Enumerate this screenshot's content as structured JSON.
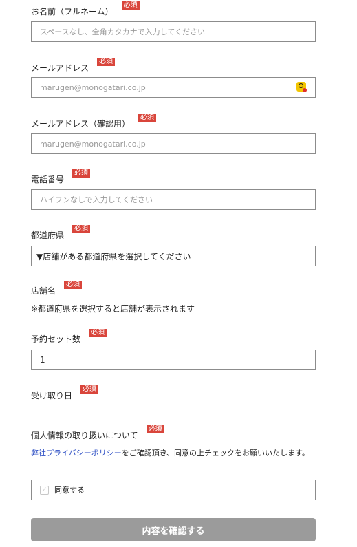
{
  "form": {
    "required_badge": "必須",
    "name": {
      "label": "お名前（フルネーム）",
      "placeholder": "スペースなし、全角カタカナで入力してください"
    },
    "email": {
      "label": "メールアドレス",
      "placeholder": "marugen@monogatari.co.jp"
    },
    "email_confirm": {
      "label": "メールアドレス（確認用）",
      "placeholder": "marugen@monogatari.co.jp"
    },
    "phone": {
      "label": "電話番号",
      "placeholder": "ハイフンなしで入力してください"
    },
    "prefecture": {
      "label": "都道府県",
      "selected": "▼店舗がある都道府県を選択してください"
    },
    "store": {
      "label": "店舗名",
      "note": "※都道府県を選択すると店舗が表示されます"
    },
    "set_count": {
      "label": "予約セット数",
      "value": "1"
    },
    "pickup_date": {
      "label": "受け取り日"
    },
    "privacy": {
      "label": "個人情報の取り扱いについて",
      "link_text": "弊社プライバシーポリシー",
      "text": "をご確認頂き、同意の上チェックをお願いいたします。",
      "agree_label": "同意する"
    },
    "submit_label": "内容を確認する"
  },
  "colors": {
    "required_badge": "#d9453b",
    "link": "#2c4ec4",
    "submit_bg": "#9b9b9b",
    "field_border": "#8c8c8c"
  },
  "icons": {
    "email_field": "password-manager-icon",
    "agree": "checkbox-icon"
  }
}
